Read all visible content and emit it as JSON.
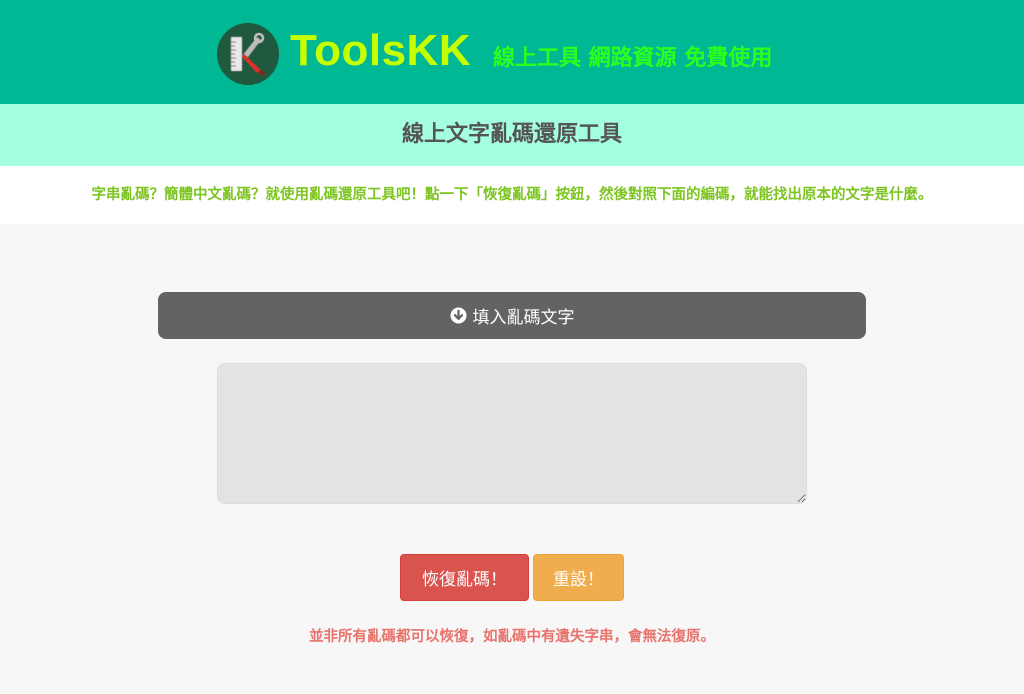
{
  "header": {
    "brand": "ToolsKK",
    "slogan": "線上工具 網路資源 免費使用",
    "logo_icon": "toolskk-logo-icon"
  },
  "page": {
    "title": "線上文字亂碼還原工具",
    "description": "字串亂碼？簡體中文亂碼？就使用亂碼還原工具吧！點一下「恢復亂碼」按鈕，然後對照下面的編碼，就能找出原本的文字是什麼。"
  },
  "input": {
    "header_label": "填入亂碼文字",
    "header_icon": "arrow-circle-down-icon",
    "value": "",
    "placeholder": ""
  },
  "buttons": {
    "restore_label": "恢復亂碼！",
    "reset_label": "重設！"
  },
  "note": "並非所有亂碼都可以恢復，如亂碼中有遺失字串，會無法復原。",
  "colors": {
    "header_bg": "#00b894",
    "brand": "#c6ff00",
    "slogan": "#2cff1c",
    "title_bar_bg": "#a3ffe0",
    "description": "#7cc520",
    "input_header_bg": "#636363",
    "restore_button": "#d9534f",
    "reset_button": "#f0ad4e",
    "note": "#e8736c"
  }
}
